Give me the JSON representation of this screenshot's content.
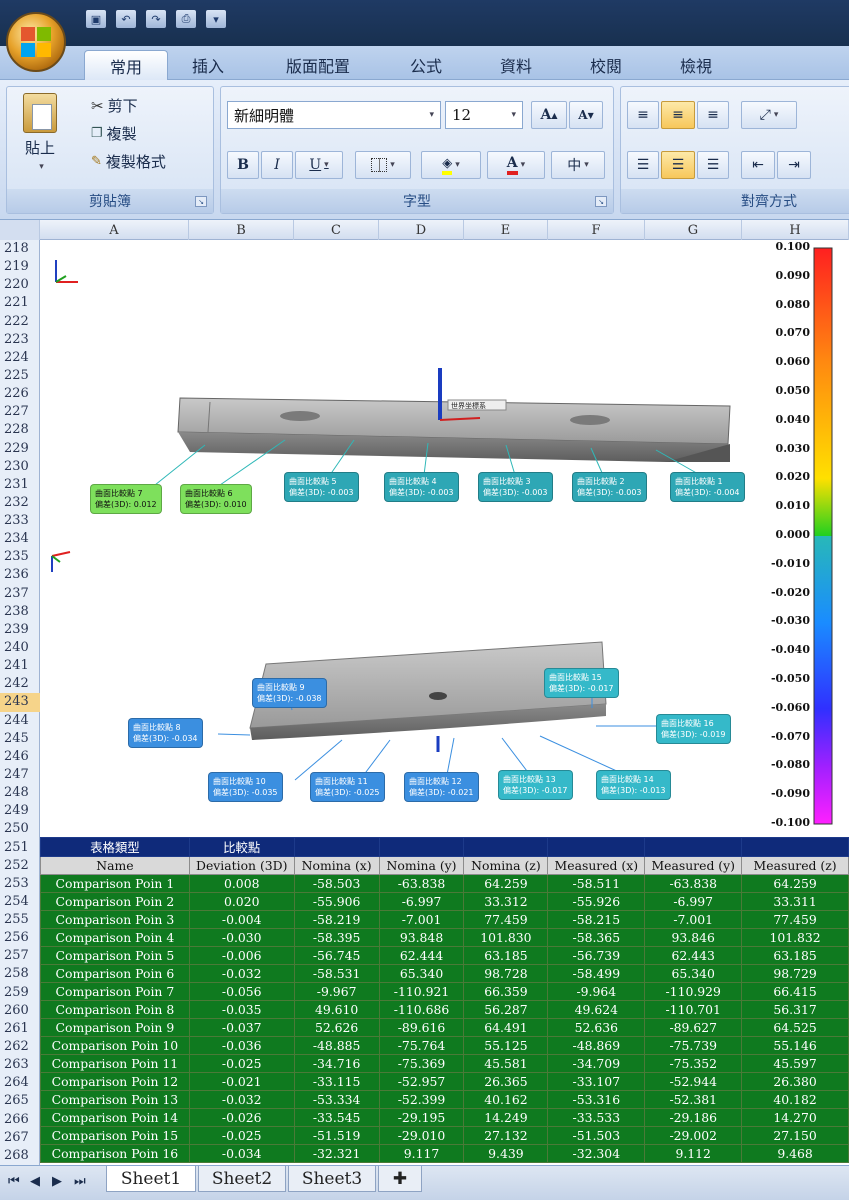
{
  "ribbon_tabs": [
    "常用",
    "插入",
    "版面配置",
    "公式",
    "資料",
    "校閱",
    "檢視"
  ],
  "clipboard": {
    "paste": "貼上",
    "cut": "剪下",
    "copy": "複製",
    "format_painter": "複製格式",
    "group": "剪貼簿"
  },
  "font": {
    "name": "新細明體",
    "size": "12",
    "group": "字型",
    "bold": "B",
    "italic": "I",
    "underline": "U",
    "grow": "A",
    "shrink": "A",
    "phonetic": "中"
  },
  "alignment": {
    "group": "對齊方式"
  },
  "columns": [
    "A",
    "B",
    "C",
    "D",
    "E",
    "F",
    "G",
    "H"
  ],
  "rows": [
    "218",
    "219",
    "220",
    "221",
    "222",
    "223",
    "224",
    "225",
    "226",
    "227",
    "228",
    "229",
    "230",
    "231",
    "232",
    "233",
    "234",
    "235",
    "236",
    "237",
    "238",
    "239",
    "240",
    "241",
    "242",
    "243",
    "244",
    "245",
    "246",
    "247",
    "248",
    "249",
    "250",
    "251",
    "252",
    "253",
    "254",
    "255",
    "256",
    "257",
    "258",
    "259",
    "260",
    "261",
    "262",
    "263",
    "264",
    "265",
    "266",
    "267",
    "268"
  ],
  "selected_row": "243",
  "picture": {
    "origin_label": "世界坐標系",
    "axis_labels": {
      "z": "z",
      "x": "x",
      "y": "y"
    },
    "scale_labels": [
      "0.100",
      "0.090",
      "0.080",
      "0.070",
      "0.060",
      "0.050",
      "0.040",
      "0.030",
      "0.020",
      "0.010",
      "0.000",
      "-0.010",
      "-0.020",
      "-0.030",
      "-0.040",
      "-0.050",
      "-0.060",
      "-0.070",
      "-0.080",
      "-0.090",
      "-0.100"
    ],
    "callouts_top": [
      {
        "l1": "曲面比較點 7",
        "l2": "偏差(3D): 0.012",
        "style": "c-green"
      },
      {
        "l1": "曲面比較點 6",
        "l2": "偏差(3D): 0.010",
        "style": "c-green"
      },
      {
        "l1": "曲面比較點 5",
        "l2": "偏差(3D): -0.003",
        "style": "c-teal"
      },
      {
        "l1": "曲面比較點 4",
        "l2": "偏差(3D): -0.003",
        "style": "c-teal"
      },
      {
        "l1": "曲面比較點 3",
        "l2": "偏差(3D): -0.003",
        "style": "c-teal"
      },
      {
        "l1": "曲面比較點 2",
        "l2": "偏差(3D): -0.003",
        "style": "c-teal"
      },
      {
        "l1": "曲面比較點 1",
        "l2": "偏差(3D): -0.004",
        "style": "c-teal"
      }
    ],
    "callouts_bottom": [
      {
        "l1": "曲面比較點 9",
        "l2": "偏差(3D): -0.038",
        "style": "c-blue"
      },
      {
        "l1": "曲面比較點 8",
        "l2": "偏差(3D): -0.034",
        "style": "c-blue"
      },
      {
        "l1": "曲面比較點 10",
        "l2": "偏差(3D): -0.035",
        "style": "c-blue"
      },
      {
        "l1": "曲面比較點 11",
        "l2": "偏差(3D): -0.025",
        "style": "c-blue"
      },
      {
        "l1": "曲面比較點 12",
        "l2": "偏差(3D): -0.021",
        "style": "c-blue"
      },
      {
        "l1": "曲面比較點 13",
        "l2": "偏差(3D): -0.017",
        "style": "c-cyan"
      },
      {
        "l1": "曲面比較點 14",
        "l2": "偏差(3D): -0.013",
        "style": "c-cyan"
      },
      {
        "l1": "曲面比較點 15",
        "l2": "偏差(3D): -0.017",
        "style": "c-cyan"
      },
      {
        "l1": "曲面比較點 16",
        "l2": "偏差(3D): -0.019",
        "style": "c-cyan"
      }
    ]
  },
  "table": {
    "header1": [
      "表格類型",
      "比較點",
      "",
      "",
      "",
      "",
      "",
      ""
    ],
    "header2": [
      "Name",
      "Deviation (3D)",
      "Nomina (x)",
      "Nomina (y)",
      "Nomina (z)",
      "Measured (x)",
      "Measured (y)",
      "Measured (z)"
    ],
    "rows": [
      [
        "Comparison Poin 1",
        "0.008",
        "-58.503",
        "-63.838",
        "64.259",
        "-58.511",
        "-63.838",
        "64.259"
      ],
      [
        "Comparison Poin 2",
        "0.020",
        "-55.906",
        "-6.997",
        "33.312",
        "-55.926",
        "-6.997",
        "33.311"
      ],
      [
        "Comparison Poin 3",
        "-0.004",
        "-58.219",
        "-7.001",
        "77.459",
        "-58.215",
        "-7.001",
        "77.459"
      ],
      [
        "Comparison Poin 4",
        "-0.030",
        "-58.395",
        "93.848",
        "101.830",
        "-58.365",
        "93.846",
        "101.832"
      ],
      [
        "Comparison Poin 5",
        "-0.006",
        "-56.745",
        "62.444",
        "63.185",
        "-56.739",
        "62.443",
        "63.185"
      ],
      [
        "Comparison Poin 6",
        "-0.032",
        "-58.531",
        "65.340",
        "98.728",
        "-58.499",
        "65.340",
        "98.729"
      ],
      [
        "Comparison Poin 7",
        "-0.056",
        "-9.967",
        "-110.921",
        "66.359",
        "-9.964",
        "-110.929",
        "66.415"
      ],
      [
        "Comparison Poin 8",
        "-0.035",
        "49.610",
        "-110.686",
        "56.287",
        "49.624",
        "-110.701",
        "56.317"
      ],
      [
        "Comparison Poin 9",
        "-0.037",
        "52.626",
        "-89.616",
        "64.491",
        "52.636",
        "-89.627",
        "64.525"
      ],
      [
        "Comparison Poin 10",
        "-0.036",
        "-48.885",
        "-75.764",
        "55.125",
        "-48.869",
        "-75.739",
        "55.146"
      ],
      [
        "Comparison Poin 11",
        "-0.025",
        "-34.716",
        "-75.369",
        "45.581",
        "-34.709",
        "-75.352",
        "45.597"
      ],
      [
        "Comparison Poin 12",
        "-0.021",
        "-33.115",
        "-52.957",
        "26.365",
        "-33.107",
        "-52.944",
        "26.380"
      ],
      [
        "Comparison Poin 13",
        "-0.032",
        "-53.334",
        "-52.399",
        "40.162",
        "-53.316",
        "-52.381",
        "40.182"
      ],
      [
        "Comparison Poin 14",
        "-0.026",
        "-33.545",
        "-29.195",
        "14.249",
        "-33.533",
        "-29.186",
        "14.270"
      ],
      [
        "Comparison Poin 15",
        "-0.025",
        "-51.519",
        "-29.010",
        "27.132",
        "-51.503",
        "-29.002",
        "27.150"
      ],
      [
        "Comparison Poin 16",
        "-0.034",
        "-32.321",
        "9.117",
        "9.439",
        "-32.304",
        "9.112",
        "9.468"
      ]
    ]
  },
  "sheets": [
    "Sheet1",
    "Sheet2",
    "Sheet3"
  ],
  "active_sheet": "Sheet1"
}
